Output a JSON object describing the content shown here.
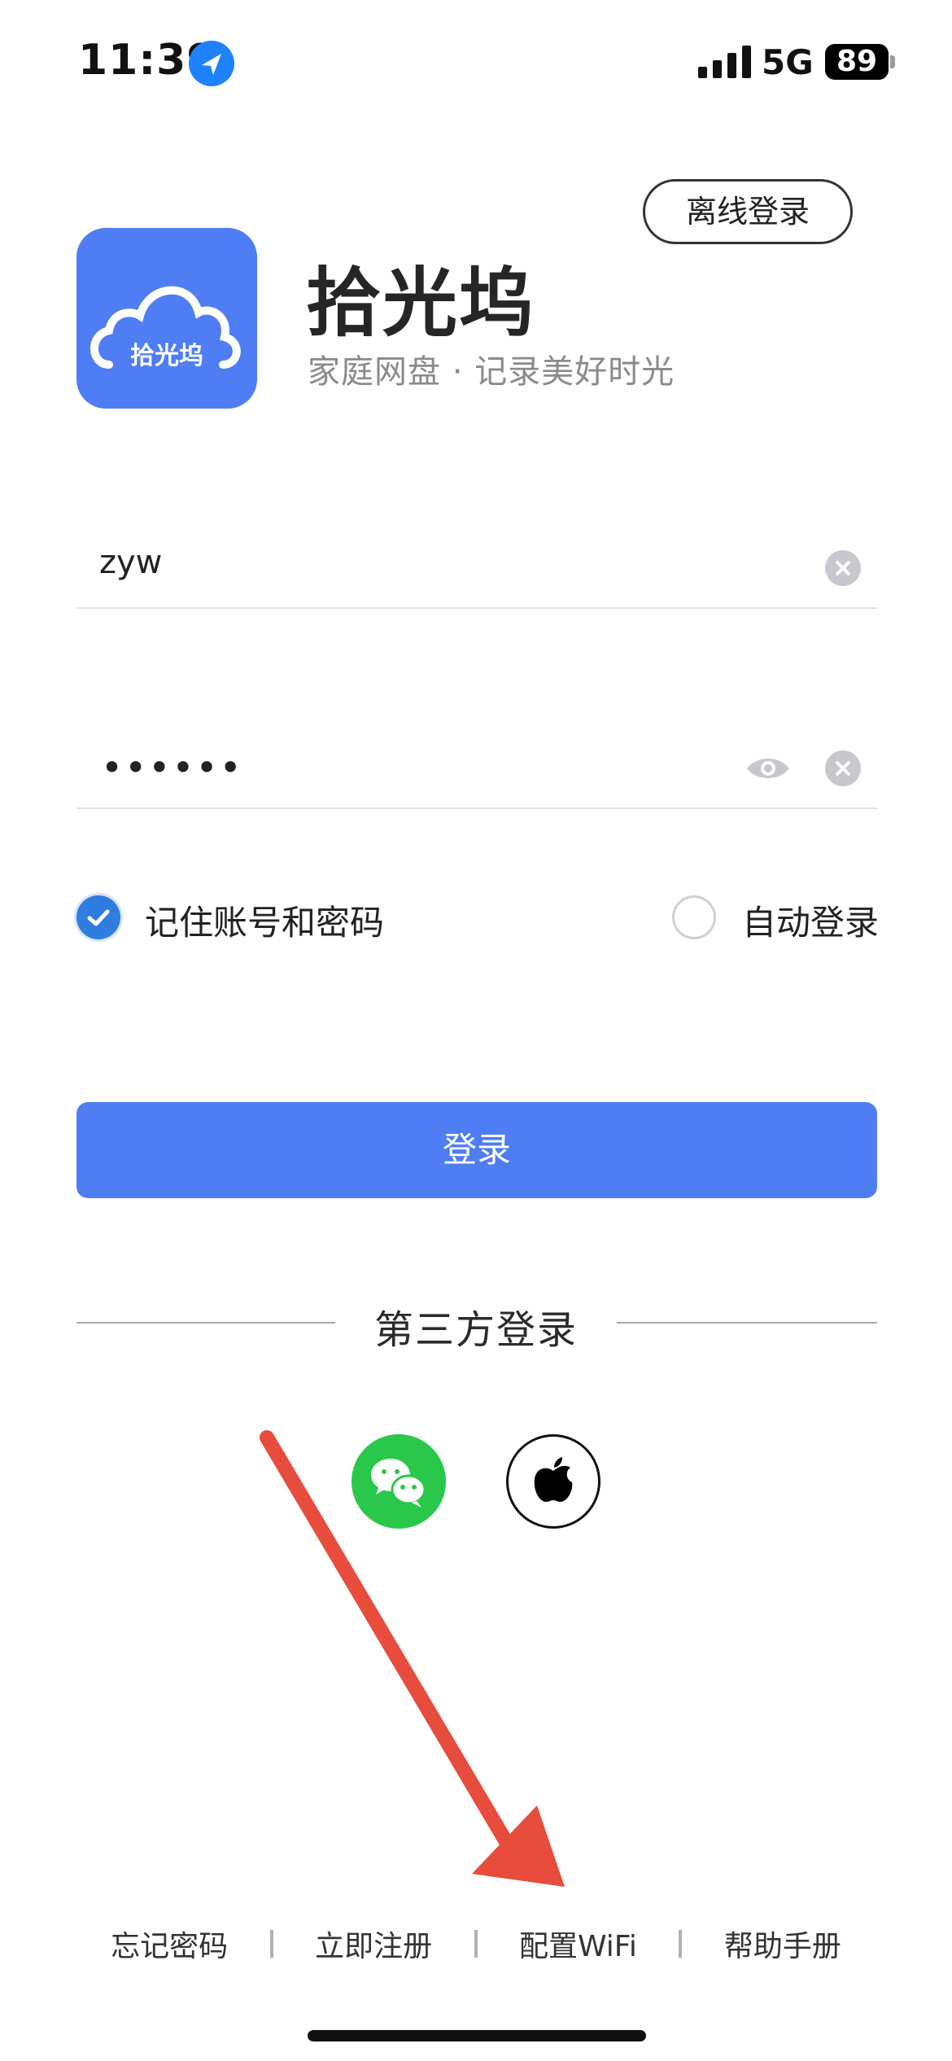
{
  "status_bar": {
    "time": "11:39",
    "network": "5G",
    "battery": "89"
  },
  "header": {
    "offline_label": "离线登录"
  },
  "app": {
    "logo_text": "拾光坞",
    "title": "拾光坞",
    "subtitle": "家庭网盘 · 记录美好时光"
  },
  "form": {
    "username": "zyw",
    "password_mask": "••••••",
    "remember_label": "记住账号和密码",
    "remember_checked": true,
    "auto_label": "自动登录",
    "auto_checked": false,
    "login_label": "登录"
  },
  "third_party": {
    "label": "第三方登录",
    "providers": [
      "wechat-icon",
      "apple-icon"
    ]
  },
  "footer": {
    "links": [
      "忘记密码",
      "立即注册",
      "配置WiFi",
      "帮助手册"
    ]
  },
  "colors": {
    "accent": "#4f7df3",
    "check": "#2f7de0",
    "wechat": "#2ac84a",
    "annotation": "#e74c3c"
  }
}
